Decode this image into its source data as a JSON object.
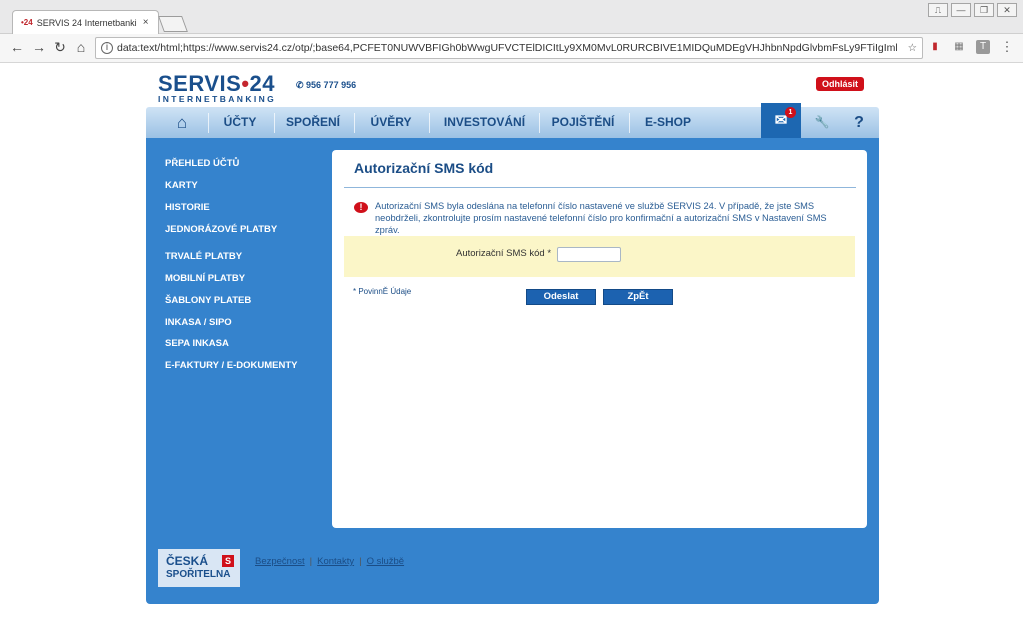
{
  "browser": {
    "tab_favicon": "•24",
    "tab_title": "SERVIS 24 Internetbanking",
    "tab_close": "×",
    "url": "data:text/html;https://www.servis24.cz/otp/;base64,PCFET0NUWVBFIGh0bWwgUFVCTElDICItLy9XM0MvL0RURCBIVE1MIDQuMDEgVHJhbnNpdGlvbmFsLy9FTiIgImh0dHA",
    "info_icon": "i",
    "star_icon": "☆",
    "back_icon": "←",
    "forward_icon": "→",
    "reload_icon": "↻",
    "home_icon": "⌂",
    "menu_icon": "⋮",
    "window_controls": [
      "⎍",
      "—",
      "❐",
      "✕"
    ]
  },
  "header": {
    "brand": "SERVIS",
    "brand_dot": "•",
    "brand_num": "24",
    "brand_sub": "INTERNETBANKING",
    "phone": "✆ 956 777 956",
    "logout": "Odhlásit"
  },
  "menu": {
    "home_icon": "⌂",
    "items": [
      "ÚČTY",
      "SPOŘENÍ",
      "ÚVĚRY",
      "INVESTOVÁNÍ",
      "POJIŠTĚNÍ",
      "E-SHOP"
    ],
    "mail_icon": "✉",
    "mail_badge": "1",
    "tools_icon": "🔧",
    "help_icon": "?"
  },
  "sidebar": {
    "items": [
      "PŘEHLED ÚČTŮ",
      "KARTY",
      "HISTORIE",
      "JEDNORÁZOVÉ PLATBY",
      "TRVALÉ PLATBY",
      "MOBILNÍ PLATBY",
      "ŠABLONY PLATEB",
      "INKASA / SIPO",
      "SEPA INKASA",
      "E-FAKTURY / E-DOKUMENTY"
    ]
  },
  "content": {
    "title": "Autorizační SMS kód",
    "alert_icon": "!",
    "alert_text": "Autorizační SMS byla odeslána na telefonní číslo nastavené ve službě SERVIS 24. V případě, že jste SMS neobdrželi, zkontrolujte prosím nastavené telefonní číslo pro konfirmační a autorizační SMS v Nastavení SMS zpráv.",
    "field_label": "Autorizační SMS kód *",
    "field_value": "",
    "required_note": "* PovinnĚ Údaje",
    "submit": "Odeslat",
    "back": "ZpĚt"
  },
  "footer": {
    "logo_line1": "ČESKÁ",
    "logo_line2": "SPOŘITELNA",
    "logo_mark": "S",
    "links": [
      "Bezpečnost",
      "Kontakty",
      "O službě"
    ],
    "separator": "|"
  },
  "colors": {
    "brand_blue": "#1a4f8c",
    "panel_blue": "#3583cd",
    "accent_red": "#d0101a",
    "highlight_yellow": "#fbf6c8"
  }
}
